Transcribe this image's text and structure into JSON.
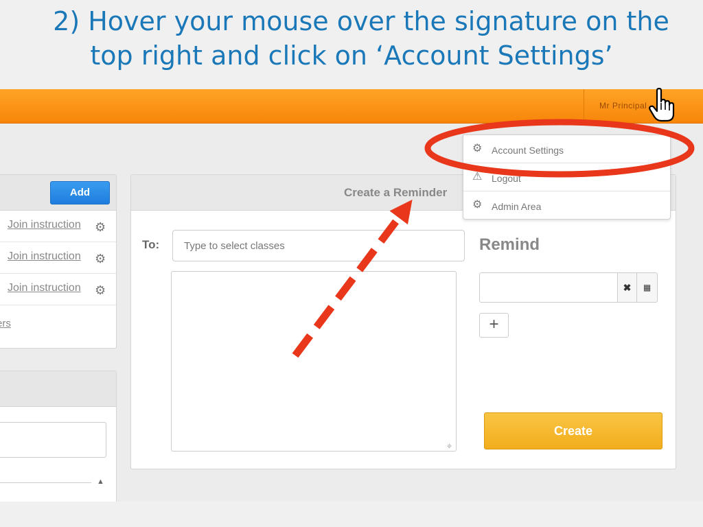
{
  "slide": {
    "title_line1": "2) Hover your mouse over the signature on the",
    "title_line2": "top right and click on ‘Account Settings’",
    "title_color": "#1a78b8"
  },
  "topbar": {
    "user_name": "Mr Principal",
    "accent_color": "#f7860a"
  },
  "account_menu": {
    "items": [
      {
        "label": "Account Settings",
        "icon": "gear-icon"
      },
      {
        "label": "Logout",
        "icon": "warning-icon"
      },
      {
        "label": "Admin Area",
        "icon": "gear-icon"
      }
    ]
  },
  "classes_panel": {
    "add_label": "Add",
    "rows": [
      {
        "link": "Join instruction",
        "icon": "gear-icon"
      },
      {
        "link": "Join instruction",
        "icon": "gear-icon"
      },
      {
        "link": "Join instruction",
        "icon": "gear-icon"
      }
    ],
    "footer_link": "ers"
  },
  "reminder": {
    "title": "Create a Reminder",
    "to_label": "To:",
    "to_placeholder": "Type to select classes",
    "remind_label": "Remind",
    "create_label": "Create",
    "create_color": "#f2ad1d"
  },
  "annotation": {
    "highlight_color": "#e8371a",
    "highlight_target": "Account Settings"
  }
}
